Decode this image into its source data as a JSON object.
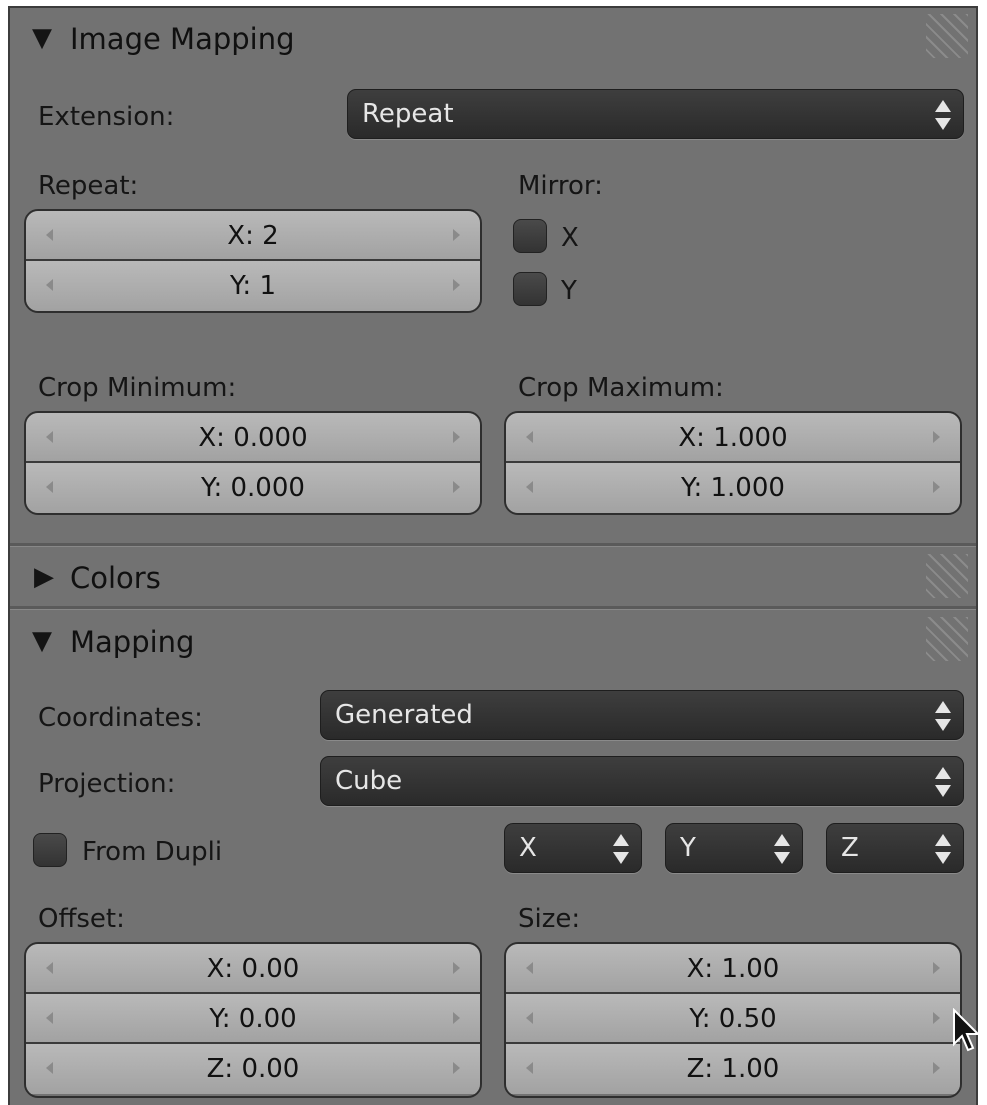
{
  "image_mapping": {
    "title": "Image Mapping",
    "extension_label": "Extension:",
    "extension_value": "Repeat",
    "repeat_label": "Repeat:",
    "repeat_x": "X: 2",
    "repeat_y": "Y: 1",
    "mirror_label": "Mirror:",
    "mirror_x": "X",
    "mirror_y": "Y",
    "crop_min_label": "Crop Minimum:",
    "crop_min_x": "X: 0.000",
    "crop_min_y": "Y: 0.000",
    "crop_max_label": "Crop Maximum:",
    "crop_max_x": "X: 1.000",
    "crop_max_y": "Y: 1.000"
  },
  "colors": {
    "title": "Colors"
  },
  "mapping": {
    "title": "Mapping",
    "coordinates_label": "Coordinates:",
    "coordinates_value": "Generated",
    "projection_label": "Projection:",
    "projection_value": "Cube",
    "from_dupli_label": "From Dupli",
    "axis_x": "X",
    "axis_y": "Y",
    "axis_z": "Z",
    "offset_label": "Offset:",
    "offset_x": "X: 0.00",
    "offset_y": "Y: 0.00",
    "offset_z": "Z: 0.00",
    "size_label": "Size:",
    "size_x": "X: 1.00",
    "size_y": "Y: 0.50",
    "size_z": "Z: 1.00"
  },
  "icons": {
    "expanded": "triangle-down-icon",
    "collapsed": "triangle-right-icon",
    "dropdown": "up-down-arrows-icon",
    "cursor": "mouse-pointer-icon"
  }
}
